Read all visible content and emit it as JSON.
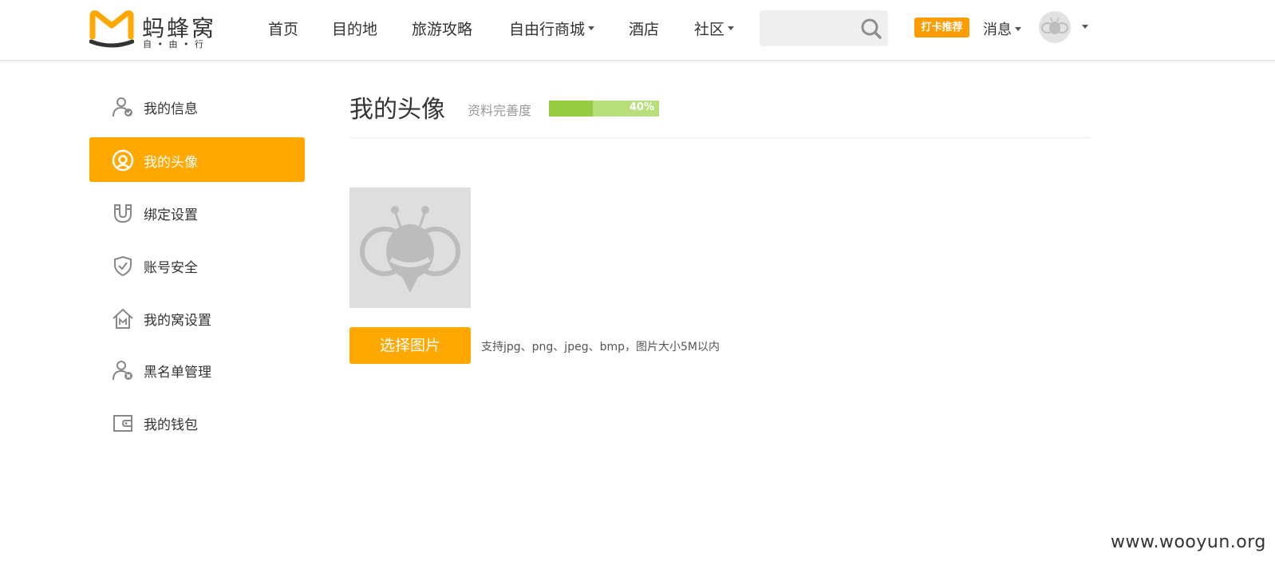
{
  "brand": {
    "name": "蚂蜂窝",
    "tagline": "自 • 由 • 行",
    "accent_color": "#ffa800",
    "logo_icon": "mafengwo-m-logo"
  },
  "nav": {
    "items": [
      {
        "label": "首页",
        "dropdown": false
      },
      {
        "label": "目的地",
        "dropdown": false
      },
      {
        "label": "旅游攻略",
        "dropdown": false
      },
      {
        "label": "自由行商城",
        "dropdown": true
      },
      {
        "label": "酒店",
        "dropdown": false
      },
      {
        "label": "社区",
        "dropdown": true
      }
    ],
    "search_placeholder": "",
    "search_icon": "search-icon",
    "badge_label": "打卡推荐",
    "badge_color": "#ff9d00",
    "messages_label": "消息",
    "user_avatar_icon": "bee-avatar-icon"
  },
  "sidebar": {
    "items": [
      {
        "label": "我的信息",
        "icon": "user-check-icon",
        "active": false
      },
      {
        "label": "我的头像",
        "icon": "avatar-icon",
        "active": true
      },
      {
        "label": "绑定设置",
        "icon": "magnet-icon",
        "active": false
      },
      {
        "label": "账号安全",
        "icon": "shield-check-icon",
        "active": false
      },
      {
        "label": "我的窝设置",
        "icon": "home-m-icon",
        "active": false
      },
      {
        "label": "黑名单管理",
        "icon": "user-block-icon",
        "active": false
      },
      {
        "label": "我的钱包",
        "icon": "wallet-icon",
        "active": false
      }
    ]
  },
  "main": {
    "title": "我的头像",
    "completeness_label": "资料完善度",
    "completeness_percent": 40,
    "completeness_text": "40%",
    "avatar_image": "default-bee-avatar",
    "upload_button_label": "选择图片",
    "upload_hint": "支持jpg、png、jpeg、bmp，图片大小5M以内"
  },
  "watermark": "www.wooyun.org"
}
